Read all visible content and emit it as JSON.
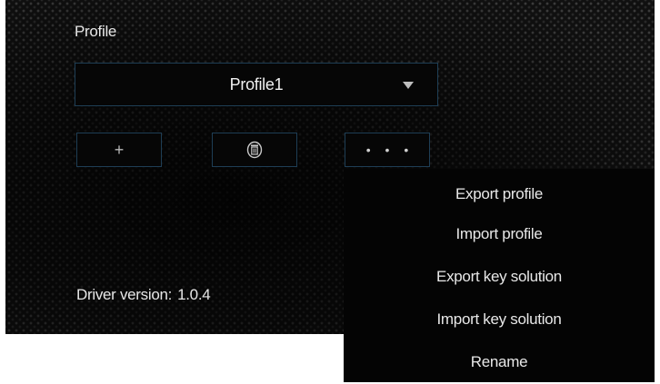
{
  "profile": {
    "label": "Profile",
    "selected": "Profile1"
  },
  "actions": {
    "add_symbol": "+",
    "more_symbol": "• • •"
  },
  "driver": {
    "label": "Driver version:",
    "version": "1.0.4"
  },
  "menu": {
    "items": [
      "Export profile",
      "Import profile",
      "Export key solution",
      "Import key solution",
      "Rename"
    ]
  },
  "colors": {
    "panel_background": "#101010",
    "control_border": "#1e3e55",
    "text": "#e6e6e6"
  }
}
